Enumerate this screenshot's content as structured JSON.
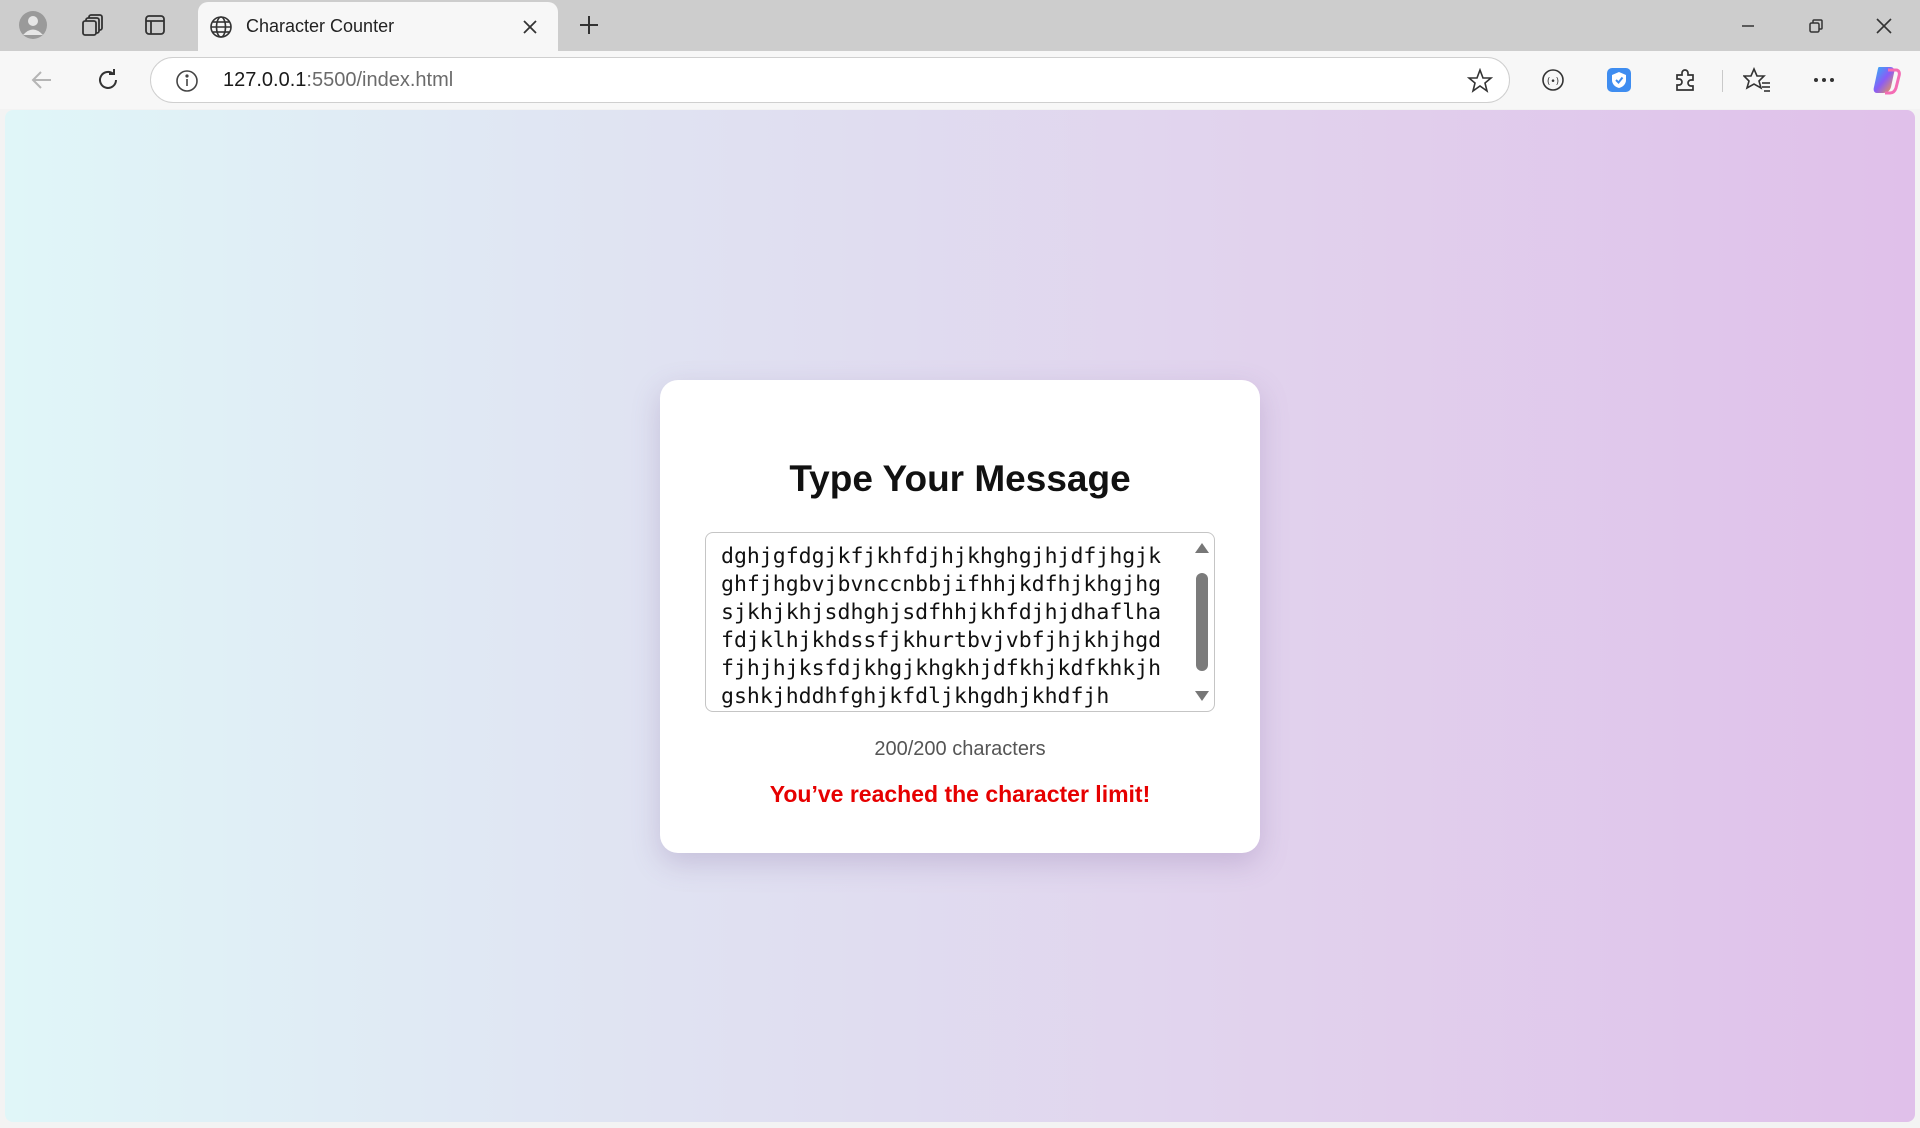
{
  "browser": {
    "tab_title": "Character Counter",
    "url_host": "127.0.0.1",
    "url_path": ":5500/index.html"
  },
  "page": {
    "heading": "Type Your Message",
    "message_text": "dghjgfdgjkfjkhfdjhjkhghgjhjdfjhgjkghfjhgbvjbvnccnbbjifhhjkdfhjkhgjhgsjkhjkhjsdhghjsdfhhjkhfdjhjdhaflhafdjklhjkhdssfjkhurtbvjvbfjhjkhjhgdfjhjhjksfdjkhgjkhgkhjdfkhjkdfkhkjhgshkjhddhfghjkfdljkhgdhjkhdfjh",
    "counter": "200/200 characters",
    "limit_warning": "You’ve reached the character limit!"
  },
  "colors": {
    "warning": "#e60000",
    "gradient_start": "#e0f6f8",
    "gradient_end": "#e0c0ea"
  },
  "icons": [
    "profile-icon",
    "workspaces-icon",
    "tab-actions-icon",
    "globe-icon",
    "close-icon",
    "plus-icon",
    "minimize-icon",
    "restore-icon",
    "back-icon",
    "refresh-icon",
    "info-icon",
    "star-icon",
    "extension-icon",
    "shield-icon",
    "puzzle-icon",
    "favorites-icon",
    "more-icon",
    "copilot-icon"
  ]
}
